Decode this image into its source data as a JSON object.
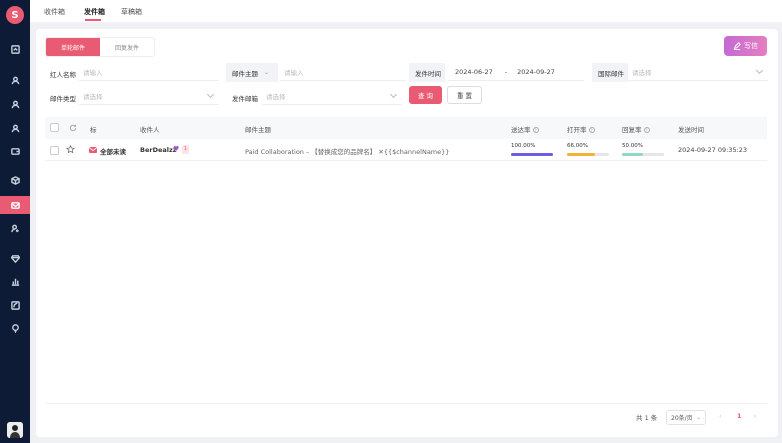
{
  "sidebar": {
    "logo": "S",
    "items": [
      "dashboard-icon",
      "user-icon",
      "user-add-icon",
      "user-check-icon",
      "wallet-icon",
      "box-icon",
      "mail-icon",
      "user-gear-icon",
      "diamond-icon",
      "chart-icon",
      "edit-icon",
      "bulb-icon"
    ],
    "active_index": 6,
    "accent": "#e95b73"
  },
  "topbar": {
    "tabs": [
      {
        "label": "收件箱"
      },
      {
        "label": "发件箱"
      },
      {
        "label": "草稿箱"
      }
    ],
    "active_tab": 1
  },
  "toolbar": {
    "seg_on": "单轮邮件",
    "seg_off": "回复发件",
    "write_label": "写信"
  },
  "filters": {
    "influencer_label": "红人名称",
    "influencer_placeholder": "请输入",
    "subject_select": "邮件主题",
    "subject_placeholder": "请输入",
    "time_label": "发件时间",
    "date_start": "2024-06-27",
    "date_sep": "-",
    "date_end": "2024-09-27",
    "intl_label": "国际邮件",
    "intl_placeholder": "请选择",
    "type_label": "邮件类型",
    "type_placeholder": "请选择",
    "sender_label": "发件邮箱",
    "sender_placeholder": "请选择",
    "query_label": "查 询",
    "reset_label": "重 置"
  },
  "table": {
    "headers": {
      "star": "标",
      "recipient": "收件人",
      "subject": "邮件主题",
      "delivery": "送达率",
      "open": "打开率",
      "reply": "回复率",
      "sent_time": "发送时间"
    },
    "rows": [
      {
        "status": "全部未读",
        "recipient": "BerDealzz",
        "badge": "1",
        "subject": "Paid Collaboration – 【替换成您的品牌名】 ✕{{$channelName}}",
        "delivery": "100.00%",
        "delivery_pct": 100,
        "open": "66.00%",
        "open_pct": 66,
        "reply": "50.00%",
        "reply_pct": 50,
        "sent_time": "2024-09-27 09:35:23"
      }
    ]
  },
  "pagination": {
    "total": "共 1 条",
    "page_size": "20条/页",
    "current": "1"
  },
  "colors": {
    "delivery": "#6a5fe0",
    "open": "#f2b33b",
    "reply": "#8fd8c5",
    "status_icon": "#e95b73"
  }
}
